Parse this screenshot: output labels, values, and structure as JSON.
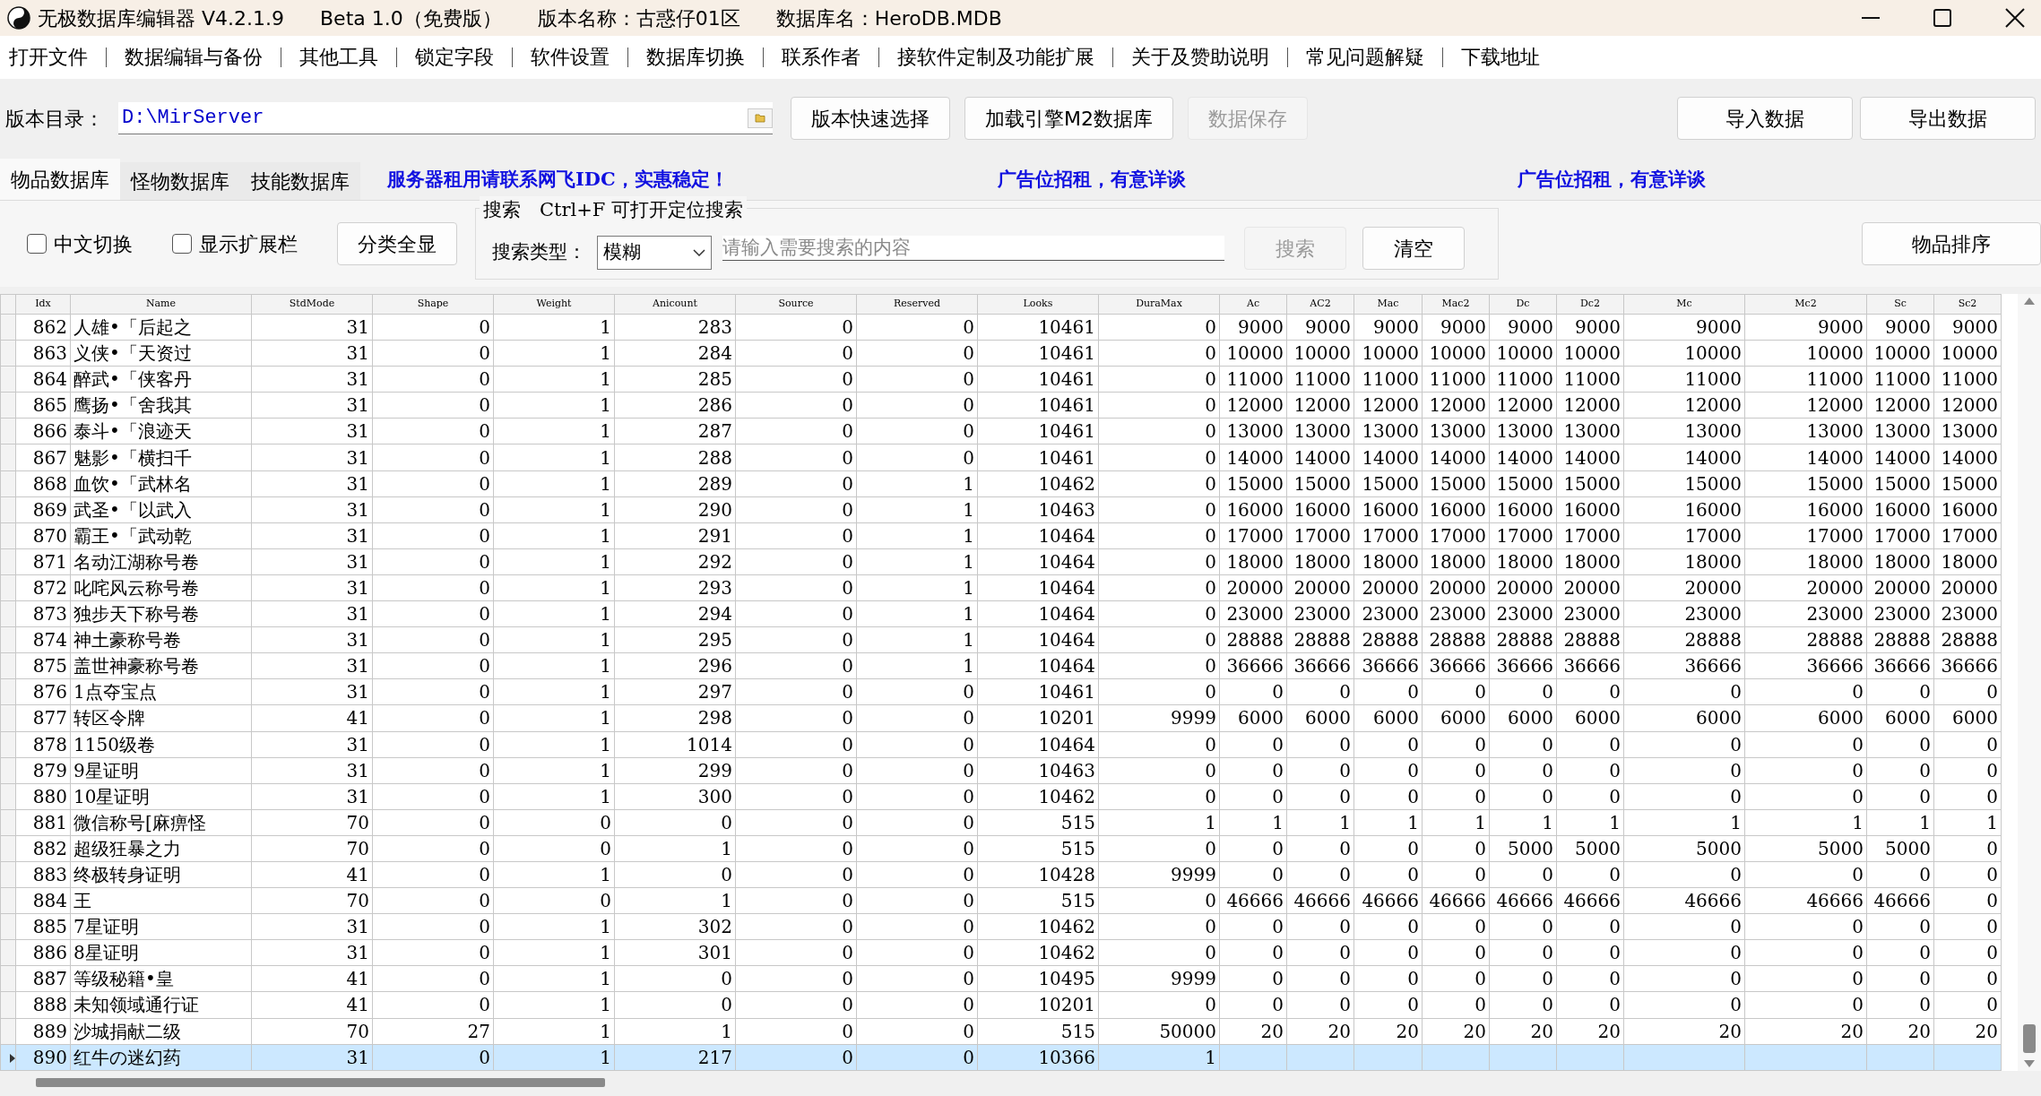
{
  "window": {
    "title_parts": [
      "无极数据库编辑器 V4.2.1.9",
      "Beta 1.0（免费版）",
      "版本名称：古惑仔01区",
      "数据库名：HeroDB.MDB"
    ]
  },
  "menu": [
    "打开文件",
    "数据编辑与备份",
    "其他工具",
    "锁定字段",
    "软件设置",
    "数据库切换",
    "联系作者",
    "接软件定制及功能扩展",
    "关于及赞助说明",
    "常见问题解疑",
    "下载地址"
  ],
  "toolbar": {
    "label": "版本目录：",
    "path": "D:\\MirServer",
    "buttons": [
      {
        "label": "版本快速选择",
        "disabled": false
      },
      {
        "label": "加载引擎M2数据库",
        "disabled": false
      },
      {
        "label": "数据保存",
        "disabled": true
      }
    ],
    "right_buttons": [
      {
        "label": "导入数据",
        "disabled": false
      },
      {
        "label": "导出数据",
        "disabled": false
      }
    ]
  },
  "tabs": [
    {
      "label": "物品数据库",
      "selected": true
    },
    {
      "label": "怪物数据库",
      "selected": false
    },
    {
      "label": "技能数据库",
      "selected": false
    }
  ],
  "ads": [
    "服务器租用请联系网飞IDC，实惠稳定！",
    "广告位招租，有意详谈",
    "广告位招租，有意详谈"
  ],
  "search": {
    "checkboxes": [
      {
        "label": "中文切换",
        "checked": false
      },
      {
        "label": "显示扩展栏",
        "checked": false
      }
    ],
    "show_all_button": "分类全显",
    "group_title": "搜索　Ctrl+F 可打开定位搜索",
    "type_label": "搜索类型：",
    "type_value": "模糊",
    "placeholder": "请输入需要搜索的内容",
    "buttons": [
      {
        "label": "搜索",
        "disabled": true
      },
      {
        "label": "清空",
        "disabled": false
      }
    ],
    "sort_button": "物品排序"
  },
  "table": {
    "columns": [
      "Idx",
      "Name",
      "StdMode",
      "Shape",
      "Weight",
      "Anicount",
      "Source",
      "Reserved",
      "Looks",
      "DuraMax",
      "Ac",
      "AC2",
      "Mac",
      "Mac2",
      "Dc",
      "Dc2",
      "Mc",
      "Mc2",
      "Sc",
      "Sc2"
    ],
    "rows": [
      {
        "selected": false,
        "cells": [
          "862",
          "人雄•「后起之",
          "31",
          "0",
          "1",
          "283",
          "0",
          "0",
          "10461",
          "0",
          "9000",
          "9000",
          "9000",
          "9000",
          "9000",
          "9000",
          "9000",
          "9000",
          "9000",
          "9000"
        ]
      },
      {
        "selected": false,
        "cells": [
          "863",
          "义侠•「天资过",
          "31",
          "0",
          "1",
          "284",
          "0",
          "0",
          "10461",
          "0",
          "10000",
          "10000",
          "10000",
          "10000",
          "10000",
          "10000",
          "10000",
          "10000",
          "10000",
          "10000"
        ]
      },
      {
        "selected": false,
        "cells": [
          "864",
          "醉武•「侠客丹",
          "31",
          "0",
          "1",
          "285",
          "0",
          "0",
          "10461",
          "0",
          "11000",
          "11000",
          "11000",
          "11000",
          "11000",
          "11000",
          "11000",
          "11000",
          "11000",
          "11000"
        ]
      },
      {
        "selected": false,
        "cells": [
          "865",
          "鹰扬•「舍我其",
          "31",
          "0",
          "1",
          "286",
          "0",
          "0",
          "10461",
          "0",
          "12000",
          "12000",
          "12000",
          "12000",
          "12000",
          "12000",
          "12000",
          "12000",
          "12000",
          "12000"
        ]
      },
      {
        "selected": false,
        "cells": [
          "866",
          "泰斗•「浪迹天",
          "31",
          "0",
          "1",
          "287",
          "0",
          "0",
          "10461",
          "0",
          "13000",
          "13000",
          "13000",
          "13000",
          "13000",
          "13000",
          "13000",
          "13000",
          "13000",
          "13000"
        ]
      },
      {
        "selected": false,
        "cells": [
          "867",
          "魅影•「横扫千",
          "31",
          "0",
          "1",
          "288",
          "0",
          "0",
          "10461",
          "0",
          "14000",
          "14000",
          "14000",
          "14000",
          "14000",
          "14000",
          "14000",
          "14000",
          "14000",
          "14000"
        ]
      },
      {
        "selected": false,
        "cells": [
          "868",
          "血饮•「武林名",
          "31",
          "0",
          "1",
          "289",
          "0",
          "1",
          "10462",
          "0",
          "15000",
          "15000",
          "15000",
          "15000",
          "15000",
          "15000",
          "15000",
          "15000",
          "15000",
          "15000"
        ]
      },
      {
        "selected": false,
        "cells": [
          "869",
          "武圣•「以武入",
          "31",
          "0",
          "1",
          "290",
          "0",
          "1",
          "10463",
          "0",
          "16000",
          "16000",
          "16000",
          "16000",
          "16000",
          "16000",
          "16000",
          "16000",
          "16000",
          "16000"
        ]
      },
      {
        "selected": false,
        "cells": [
          "870",
          "霸王•「武动乾",
          "31",
          "0",
          "1",
          "291",
          "0",
          "1",
          "10464",
          "0",
          "17000",
          "17000",
          "17000",
          "17000",
          "17000",
          "17000",
          "17000",
          "17000",
          "17000",
          "17000"
        ]
      },
      {
        "selected": false,
        "cells": [
          "871",
          "名动江湖称号卷",
          "31",
          "0",
          "1",
          "292",
          "0",
          "1",
          "10464",
          "0",
          "18000",
          "18000",
          "18000",
          "18000",
          "18000",
          "18000",
          "18000",
          "18000",
          "18000",
          "18000"
        ]
      },
      {
        "selected": false,
        "cells": [
          "872",
          "叱咤风云称号卷",
          "31",
          "0",
          "1",
          "293",
          "0",
          "1",
          "10464",
          "0",
          "20000",
          "20000",
          "20000",
          "20000",
          "20000",
          "20000",
          "20000",
          "20000",
          "20000",
          "20000"
        ]
      },
      {
        "selected": false,
        "cells": [
          "873",
          "独步天下称号卷",
          "31",
          "0",
          "1",
          "294",
          "0",
          "1",
          "10464",
          "0",
          "23000",
          "23000",
          "23000",
          "23000",
          "23000",
          "23000",
          "23000",
          "23000",
          "23000",
          "23000"
        ]
      },
      {
        "selected": false,
        "cells": [
          "874",
          "神土豪称号卷",
          "31",
          "0",
          "1",
          "295",
          "0",
          "1",
          "10464",
          "0",
          "28888",
          "28888",
          "28888",
          "28888",
          "28888",
          "28888",
          "28888",
          "28888",
          "28888",
          "28888"
        ]
      },
      {
        "selected": false,
        "cells": [
          "875",
          "盖世神豪称号卷",
          "31",
          "0",
          "1",
          "296",
          "0",
          "1",
          "10464",
          "0",
          "36666",
          "36666",
          "36666",
          "36666",
          "36666",
          "36666",
          "36666",
          "36666",
          "36666",
          "36666"
        ]
      },
      {
        "selected": false,
        "cells": [
          "876",
          "1点夺宝点",
          "31",
          "0",
          "1",
          "297",
          "0",
          "0",
          "10461",
          "0",
          "0",
          "0",
          "0",
          "0",
          "0",
          "0",
          "0",
          "0",
          "0",
          "0"
        ]
      },
      {
        "selected": false,
        "cells": [
          "877",
          "转区令牌",
          "41",
          "0",
          "1",
          "298",
          "0",
          "0",
          "10201",
          "9999",
          "6000",
          "6000",
          "6000",
          "6000",
          "6000",
          "6000",
          "6000",
          "6000",
          "6000",
          "6000"
        ]
      },
      {
        "selected": false,
        "cells": [
          "878",
          "1150级卷",
          "31",
          "0",
          "1",
          "1014",
          "0",
          "0",
          "10464",
          "0",
          "0",
          "0",
          "0",
          "0",
          "0",
          "0",
          "0",
          "0",
          "0",
          "0"
        ]
      },
      {
        "selected": false,
        "cells": [
          "879",
          "9星证明",
          "31",
          "0",
          "1",
          "299",
          "0",
          "0",
          "10463",
          "0",
          "0",
          "0",
          "0",
          "0",
          "0",
          "0",
          "0",
          "0",
          "0",
          "0"
        ]
      },
      {
        "selected": false,
        "cells": [
          "880",
          "10星证明",
          "31",
          "0",
          "1",
          "300",
          "0",
          "0",
          "10462",
          "0",
          "0",
          "0",
          "0",
          "0",
          "0",
          "0",
          "0",
          "0",
          "0",
          "0"
        ]
      },
      {
        "selected": false,
        "cells": [
          "881",
          "微信称号[麻痹怪",
          "70",
          "0",
          "0",
          "0",
          "0",
          "0",
          "515",
          "1",
          "1",
          "1",
          "1",
          "1",
          "1",
          "1",
          "1",
          "1",
          "1",
          "1"
        ]
      },
      {
        "selected": false,
        "cells": [
          "882",
          "超级狂暴之力",
          "70",
          "0",
          "0",
          "1",
          "0",
          "0",
          "515",
          "0",
          "0",
          "0",
          "0",
          "0",
          "5000",
          "5000",
          "5000",
          "5000",
          "5000",
          "0"
        ]
      },
      {
        "selected": false,
        "cells": [
          "883",
          "终极转身证明",
          "41",
          "0",
          "1",
          "0",
          "0",
          "0",
          "10428",
          "9999",
          "0",
          "0",
          "0",
          "0",
          "0",
          "0",
          "0",
          "0",
          "0",
          "0"
        ]
      },
      {
        "selected": false,
        "cells": [
          "884",
          "王",
          "70",
          "0",
          "0",
          "1",
          "0",
          "0",
          "515",
          "0",
          "46666",
          "46666",
          "46666",
          "46666",
          "46666",
          "46666",
          "46666",
          "46666",
          "46666",
          "0"
        ]
      },
      {
        "selected": false,
        "cells": [
          "885",
          "7星证明",
          "31",
          "0",
          "1",
          "302",
          "0",
          "0",
          "10462",
          "0",
          "0",
          "0",
          "0",
          "0",
          "0",
          "0",
          "0",
          "0",
          "0",
          "0"
        ]
      },
      {
        "selected": false,
        "cells": [
          "886",
          "8星证明",
          "31",
          "0",
          "1",
          "301",
          "0",
          "0",
          "10462",
          "0",
          "0",
          "0",
          "0",
          "0",
          "0",
          "0",
          "0",
          "0",
          "0",
          "0"
        ]
      },
      {
        "selected": false,
        "cells": [
          "887",
          "等级秘籍•皇",
          "41",
          "0",
          "1",
          "0",
          "0",
          "0",
          "10495",
          "9999",
          "0",
          "0",
          "0",
          "0",
          "0",
          "0",
          "0",
          "0",
          "0",
          "0"
        ]
      },
      {
        "selected": false,
        "cells": [
          "888",
          "未知领域通行证",
          "41",
          "0",
          "1",
          "0",
          "0",
          "0",
          "10201",
          "0",
          "0",
          "0",
          "0",
          "0",
          "0",
          "0",
          "0",
          "0",
          "0",
          "0"
        ]
      },
      {
        "selected": false,
        "cells": [
          "889",
          "沙城捐献二级",
          "70",
          "27",
          "1",
          "1",
          "0",
          "0",
          "515",
          "50000",
          "20",
          "20",
          "20",
          "20",
          "20",
          "20",
          "20",
          "20",
          "20",
          "20"
        ]
      },
      {
        "selected": true,
        "cells": [
          "890",
          "红牛の迷幻药",
          "31",
          "0",
          "1",
          "217",
          "0",
          "0",
          "10366",
          "1"
        ]
      }
    ]
  }
}
